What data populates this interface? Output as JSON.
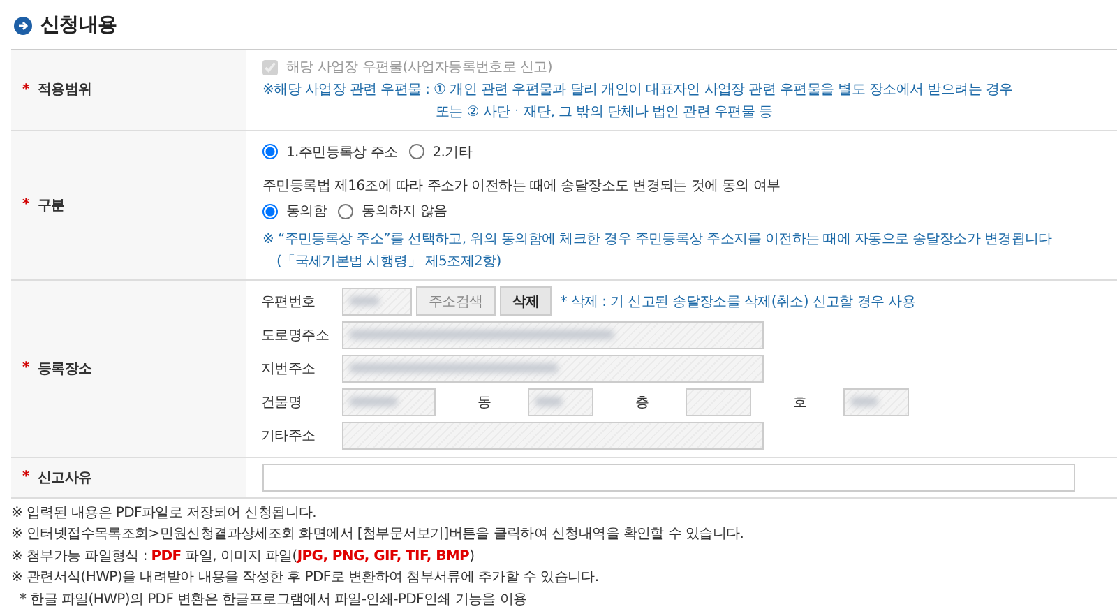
{
  "section_title": "신청내용",
  "required_mark": "*",
  "rows": [
    {
      "kind": "scope",
      "label": "적용범위",
      "required": true,
      "checkbox": {
        "label": "해당 사업장 우편물(사업자등록번호로 신고)",
        "checked": true,
        "disabled": true
      },
      "notes": [
        "※해당 사업장 관련 우편물 : ① 개인 관련 우편물과 달리 개인이 대표자인 사업장 관련 우편물을 별도 장소에서 받으려는 경우",
        "또는 ② 사단ㆍ재단, 그 밖의 단체나 법인 관련 우편물 등"
      ]
    },
    {
      "kind": "type",
      "label": "구분",
      "required": true,
      "radios": [
        {
          "label": "1.주민등록상 주소",
          "selected": true
        },
        {
          "label": "2.기타",
          "selected": false
        }
      ],
      "question": "주민등록법 제16조에 따라 주소가 이전하는 때에 송달장소도 변경되는 것에 동의 여부",
      "consent": [
        {
          "label": "동의함",
          "selected": true
        },
        {
          "label": "동의하지 않음",
          "selected": false
        }
      ],
      "notes": [
        "※ “주민등록상 주소”를 선택하고, 위의 동의함에 체크한 경우 주민등록상 주소지를 이전하는 때에 자동으로 송달장소가 변경됩니다",
        "(「국세기본법 시행령」 제5조제2항)"
      ]
    },
    {
      "kind": "address",
      "label": "등록장소",
      "required": true,
      "postcode_label": "우편번호",
      "search_button": "주소검색",
      "delete_button": "삭제",
      "delete_note": "* 삭제 : 기 신고된 송달장소를 삭제(취소) 신고할 경우 사용",
      "road_label": "도로명주소",
      "lot_label": "지번주소",
      "building_label": "건물명",
      "dong_label": "동",
      "floor_label": "층",
      "ho_label": "호",
      "other_label": "기타주소"
    },
    {
      "kind": "reason",
      "label": "신고사유",
      "required": true
    }
  ],
  "footnotes": [
    "※ 입력된 내용은 PDF파일로 저장되어 신청됩니다.",
    "※ 인터넷접수목록조회>민원신청결과상세조회 화면에서 [첨부문서보기]버튼을 클릭하여 신청내역을 확인할 수 있습니다.",
    "※ 첨부가능 파일형식 : **PDF** 파일, 이미지 파일(**JPG, PNG, GIF, TIF, BMP**)",
    "※ 관련서식(HWP)을 내려받아 내용을 작성한 후 PDF로 변환하여 첨부서류에 추가할 수 있습니다.",
    "* 한글 파일(HWP)의 PDF 변환은 한글프로그램에서 파일-인쇄-PDF인쇄 기능을 이용"
  ]
}
